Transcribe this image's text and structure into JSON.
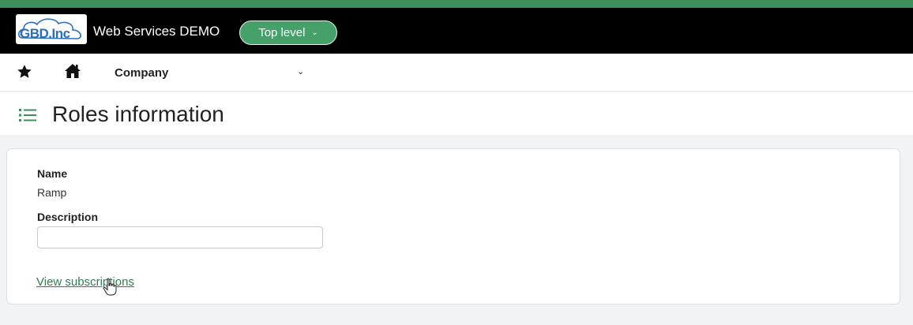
{
  "header": {
    "logo_text": "GBD.Inc",
    "app_title": "Web Services DEMO",
    "level_button": "Top level",
    "accent_color": "#3f8f5a"
  },
  "nav": {
    "favorites_icon": "star-icon",
    "home_icon": "home-icon",
    "company_label": "Company"
  },
  "page": {
    "title": "Roles information",
    "title_icon": "list-icon"
  },
  "form": {
    "name_label": "Name",
    "name_value": "Ramp",
    "description_label": "Description",
    "description_value": "",
    "view_subscriptions_link": "View subscriptions"
  }
}
